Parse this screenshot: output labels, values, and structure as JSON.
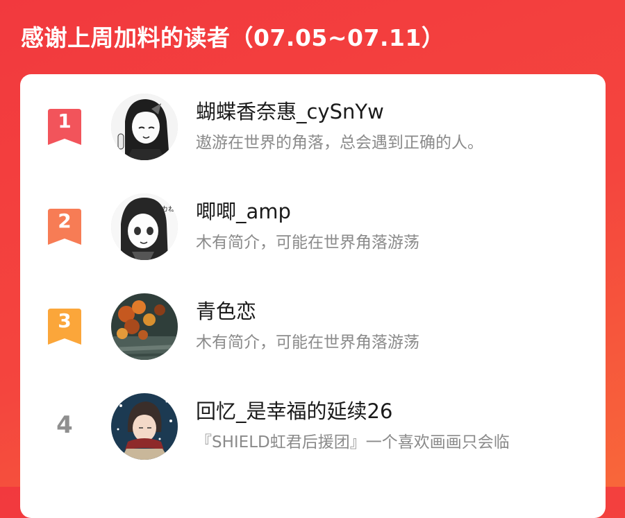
{
  "header": {
    "title": "感谢上周加料的读者（07.05~07.11）"
  },
  "colors": {
    "rank1": "#f2545b",
    "rank2": "#f77c55",
    "rank3": "#fba63a",
    "background": "#f3403d"
  },
  "readers": [
    {
      "rank": "1",
      "name": "蝴蝶香奈惠_cySnYw",
      "bio": "遨游在世界的角落，总会遇到正确的人。",
      "avatar_icon": "avatar-manga-girl-icon"
    },
    {
      "rank": "2",
      "name": "唧唧_amp",
      "bio": "木有简介，可能在世界角落游荡",
      "avatar_icon": "avatar-anime-girl-icon"
    },
    {
      "rank": "3",
      "name": "青色恋",
      "bio": "木有简介，可能在世界角落游荡",
      "avatar_icon": "avatar-autumn-leaves-icon"
    },
    {
      "rank": "4",
      "name": "回忆_是幸福的延续26",
      "bio": "『SHIELD虹君后援团』一个喜欢画画只会临",
      "avatar_icon": "avatar-boy-scarf-icon"
    }
  ]
}
